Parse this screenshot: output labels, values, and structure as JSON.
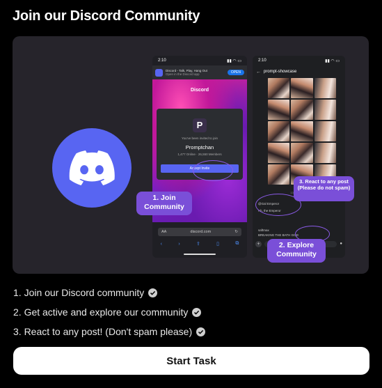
{
  "header": {
    "title": "Join our Discord Community"
  },
  "phone1": {
    "time": "2:10",
    "banner_title": "Discord - Talk, Play, Hang Out",
    "banner_sub": "Open in the Discord app",
    "banner_open": "OPEN",
    "brand": "Discord",
    "invite_text": "You've been invited to join",
    "server_name": "Promptchan",
    "members": "1,477 Online  ·  26,550 Members",
    "accept_label": "Accept Invite",
    "url": "discord.com",
    "url_aa": "AA"
  },
  "phone2": {
    "time": "2:10",
    "channel": "prompt-showcase",
    "date": "13 June 2024",
    "msg1_user": "@Gal Emperor",
    "msg1_text": "Ah, the Emperor",
    "msg2_user": "saftmax",
    "msg2_text": "BREAKING THE BATH GOD"
  },
  "callouts": {
    "join": "1. Join Community",
    "react": "3. React to any post (Please do not spam)",
    "explore": "2. Explore Community"
  },
  "steps": [
    {
      "label": "1. Join our Discord community"
    },
    {
      "label": "2. Get active and explore our community"
    },
    {
      "label": "3. React to any post! (Don't spam please)"
    }
  ],
  "cta": {
    "label": "Start Task"
  },
  "colors": {
    "discord_blurple": "#5865f2",
    "callout_purple": "#7a4fd8",
    "panel_bg": "#26242b"
  }
}
